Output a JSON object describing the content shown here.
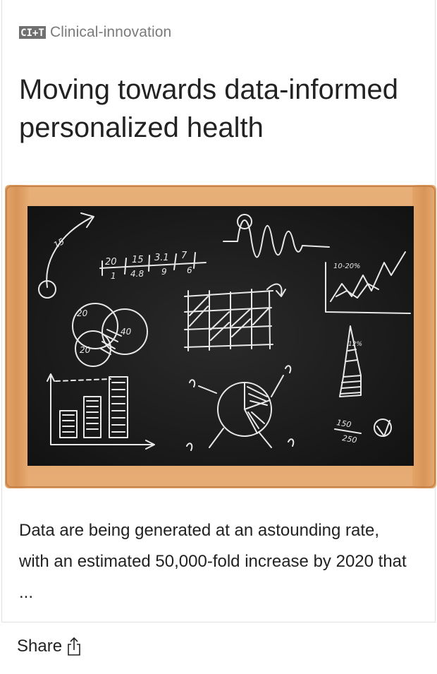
{
  "category": {
    "logo_icon": "cit-logo-icon",
    "label": "Clinical-innovation"
  },
  "title": "Moving towards data-informed personalized health",
  "hero_image": {
    "icon": "chalkboard-data-sketch-image",
    "chalk_labels": {
      "fraction_top": [
        "20",
        "15",
        "3.1",
        "7"
      ],
      "fraction_bottom": [
        "1",
        "4.8",
        "9",
        "6"
      ],
      "arrow_label": "15",
      "percent_label": "10-20%",
      "arrow_up_label": "12%",
      "venn": [
        "20",
        "40",
        "20"
      ],
      "ratio_top": "150",
      "ratio_bottom": "250"
    }
  },
  "excerpt": "Data are being generated at an astounding rate, with an estimated 50,000-fold increase by 2020 that ...",
  "footer": {
    "share_label": "Share",
    "share_icon": "share-icon"
  }
}
